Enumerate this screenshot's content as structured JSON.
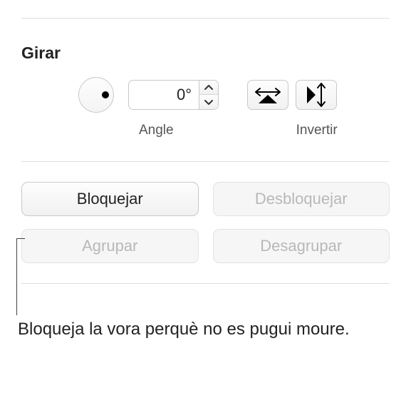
{
  "section": {
    "title": "Girar"
  },
  "rotate": {
    "angle_value": "0°",
    "angle_label": "Angle",
    "invert_label": "Invertir"
  },
  "buttons": {
    "lock": "Bloquejar",
    "unlock": "Desbloquejar",
    "group": "Agrupar",
    "ungroup": "Desagrupar"
  },
  "callout": {
    "text": "Bloqueja la vora perquè no es pugui moure."
  }
}
